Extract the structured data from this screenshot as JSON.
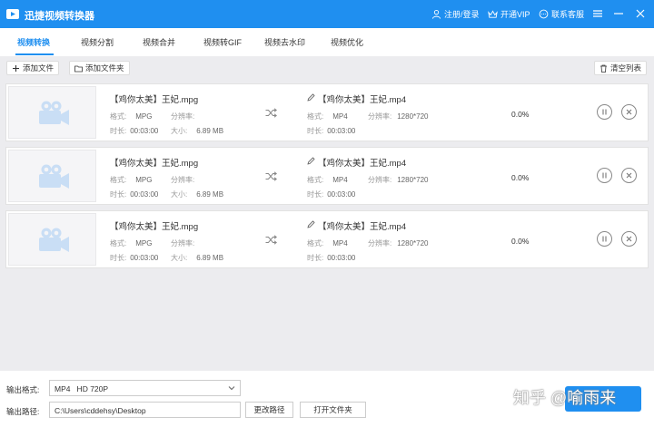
{
  "app": {
    "title": "迅捷视频转换器"
  },
  "header": {
    "login_label": "注册/登录",
    "vip_label": "开通VIP",
    "support_label": "联系客服"
  },
  "tabs": [
    {
      "label": "视频转换",
      "active": true
    },
    {
      "label": "视频分割"
    },
    {
      "label": "视频合并"
    },
    {
      "label": "视频转GIF"
    },
    {
      "label": "视频去水印"
    },
    {
      "label": "视频优化"
    }
  ],
  "toolbar": {
    "add_file": "添加文件",
    "add_folder": "添加文件夹",
    "clear_list": "清空列表"
  },
  "tasks": [
    {
      "src_name": "【鸡你太美】王妃.mpg",
      "src_format_label": "格式:",
      "src_format": "MPG",
      "src_res_label": "分辨率:",
      "src_res": "",
      "src_duration_label": "时长:",
      "src_duration": "00:03:00",
      "src_size_label": "大小:",
      "src_size": "6.89 MB",
      "dst_name": "【鸡你太美】王妃.mp4",
      "dst_format_label": "格式:",
      "dst_format": "MP4",
      "dst_res_label": "分辨率:",
      "dst_res": "1280*720",
      "dst_duration_label": "时长:",
      "dst_duration": "00:03:00",
      "progress": "0.0%"
    },
    {
      "src_name": "【鸡你太美】王妃.mpg",
      "src_format_label": "格式:",
      "src_format": "MPG",
      "src_res_label": "分辨率:",
      "src_res": "",
      "src_duration_label": "时长:",
      "src_duration": "00:03:00",
      "src_size_label": "大小:",
      "src_size": "6.89 MB",
      "dst_name": "【鸡你太美】王妃.mp4",
      "dst_format_label": "格式:",
      "dst_format": "MP4",
      "dst_res_label": "分辨率:",
      "dst_res": "1280*720",
      "dst_duration_label": "时长:",
      "dst_duration": "00:03:00",
      "progress": "0.0%"
    },
    {
      "src_name": "【鸡你太美】王妃.mpg",
      "src_format_label": "格式:",
      "src_format": "MPG",
      "src_res_label": "分辨率:",
      "src_res": "",
      "src_duration_label": "时长:",
      "src_duration": "00:03:00",
      "src_size_label": "大小:",
      "src_size": "6.89 MB",
      "dst_name": "【鸡你太美】王妃.mp4",
      "dst_format_label": "格式:",
      "dst_format": "MP4",
      "dst_res_label": "分辨率:",
      "dst_res": "1280*720",
      "dst_duration_label": "时长:",
      "dst_duration": "00:03:00",
      "progress": "0.0%"
    }
  ],
  "bottom": {
    "format_label": "输出格式:",
    "format_value": "MP4   HD 720P",
    "path_label": "输出路径:",
    "path_value": "C:\\Users\\cddehsy\\Desktop",
    "change_path": "更改路径",
    "open_folder": "打开文件夹"
  },
  "watermark": "知乎 @喻雨来",
  "colors": {
    "accent": "#1f8ff0",
    "background": "#ececef"
  }
}
